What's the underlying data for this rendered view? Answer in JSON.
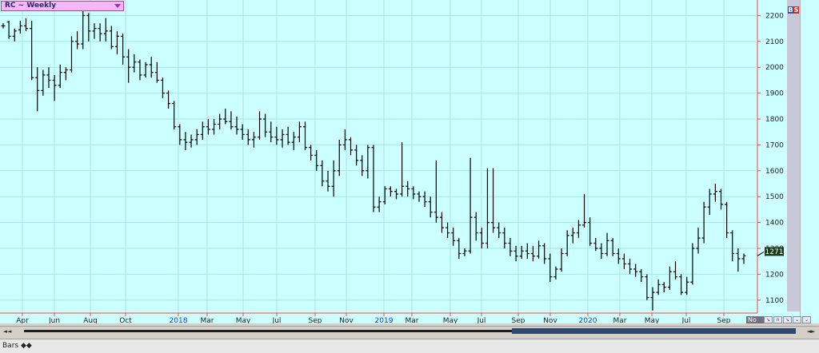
{
  "window": {
    "title": "RC ~ Weekly"
  },
  "buttons": {
    "buy": "B",
    "sell": "S"
  },
  "nav": {
    "date_corner": "No"
  },
  "bottom": {
    "tab_label": "Bars ◆◆"
  },
  "colors": {
    "background": "#ccffff",
    "axis": "#ff4040",
    "bars": "#000000",
    "price_label_bg": "#1a3a1a"
  },
  "chart_data": {
    "type": "bar",
    "title": "RC ~ Weekly",
    "ylim": [
      1050,
      2260
    ],
    "yticks": [
      1100,
      1200,
      1300,
      1400,
      1500,
      1600,
      1700,
      1800,
      1900,
      2000,
      2100,
      2200
    ],
    "x_labels": [
      "Apr",
      "Jun",
      "Aug",
      "Oct",
      "2018",
      "Mar",
      "May",
      "Jul",
      "Sep",
      "Nov",
      "2019",
      "Mar",
      "May",
      "Jul",
      "Sep",
      "Nov",
      "2020",
      "Mar",
      "May",
      "Jul",
      "Sep"
    ],
    "last_price": "1271",
    "grid": true,
    "bars": [
      [
        2160,
        2170,
        2150,
        2160
      ],
      [
        2175,
        2180,
        2110,
        2120
      ],
      [
        2120,
        2150,
        2100,
        2140
      ],
      [
        2145,
        2180,
        2130,
        2160
      ],
      [
        2160,
        2190,
        2140,
        2150
      ],
      [
        2150,
        2180,
        1950,
        1960
      ],
      [
        1960,
        2000,
        1830,
        1910
      ],
      [
        1910,
        1990,
        1890,
        1970
      ],
      [
        1970,
        2000,
        1920,
        1950
      ],
      [
        1950,
        1970,
        1870,
        1930
      ],
      [
        1930,
        2010,
        1920,
        1980
      ],
      [
        1980,
        2000,
        1950,
        1990
      ],
      [
        1990,
        2120,
        1980,
        2100
      ],
      [
        2100,
        2140,
        2070,
        2090
      ],
      [
        2090,
        2230,
        2070,
        2200
      ],
      [
        2200,
        2210,
        2100,
        2140
      ],
      [
        2140,
        2170,
        2110,
        2150
      ],
      [
        2150,
        2170,
        2100,
        2130
      ],
      [
        2130,
        2190,
        2100,
        2140
      ],
      [
        2140,
        2160,
        2070,
        2080
      ],
      [
        2080,
        2140,
        2050,
        2120
      ],
      [
        2120,
        2130,
        2010,
        2040
      ],
      [
        2040,
        2070,
        1940,
        2000
      ],
      [
        2000,
        2050,
        1980,
        2020
      ],
      [
        2020,
        2030,
        1950,
        1970
      ],
      [
        1970,
        2020,
        1960,
        2010
      ],
      [
        2010,
        2040,
        1960,
        1980
      ],
      [
        1980,
        2020,
        1940,
        1950
      ],
      [
        1950,
        1960,
        1880,
        1900
      ],
      [
        1900,
        1910,
        1840,
        1860
      ],
      [
        1860,
        1870,
        1760,
        1770
      ],
      [
        1770,
        1780,
        1700,
        1720
      ],
      [
        1720,
        1750,
        1680,
        1710
      ],
      [
        1710,
        1740,
        1690,
        1720
      ],
      [
        1720,
        1760,
        1700,
        1740
      ],
      [
        1740,
        1790,
        1720,
        1770
      ],
      [
        1770,
        1800,
        1740,
        1760
      ],
      [
        1760,
        1800,
        1740,
        1780
      ],
      [
        1780,
        1820,
        1760,
        1800
      ],
      [
        1800,
        1840,
        1780,
        1790
      ],
      [
        1790,
        1830,
        1760,
        1770
      ],
      [
        1770,
        1810,
        1740,
        1760
      ],
      [
        1760,
        1780,
        1720,
        1740
      ],
      [
        1740,
        1760,
        1700,
        1720
      ],
      [
        1720,
        1750,
        1690,
        1730
      ],
      [
        1730,
        1830,
        1720,
        1800
      ],
      [
        1800,
        1820,
        1730,
        1750
      ],
      [
        1750,
        1790,
        1710,
        1730
      ],
      [
        1730,
        1770,
        1700,
        1720
      ],
      [
        1720,
        1760,
        1690,
        1740
      ],
      [
        1740,
        1770,
        1700,
        1710
      ],
      [
        1710,
        1750,
        1680,
        1730
      ],
      [
        1730,
        1790,
        1710,
        1770
      ],
      [
        1770,
        1790,
        1680,
        1690
      ],
      [
        1690,
        1700,
        1640,
        1660
      ],
      [
        1660,
        1680,
        1600,
        1620
      ],
      [
        1620,
        1640,
        1540,
        1560
      ],
      [
        1560,
        1600,
        1520,
        1540
      ],
      [
        1540,
        1640,
        1500,
        1600
      ],
      [
        1600,
        1720,
        1580,
        1700
      ],
      [
        1700,
        1760,
        1680,
        1720
      ],
      [
        1720,
        1730,
        1660,
        1680
      ],
      [
        1680,
        1700,
        1620,
        1640
      ],
      [
        1640,
        1660,
        1580,
        1600
      ],
      [
        1600,
        1700,
        1570,
        1690
      ],
      [
        1690,
        1700,
        1440,
        1460
      ],
      [
        1460,
        1500,
        1440,
        1480
      ],
      [
        1480,
        1540,
        1470,
        1530
      ],
      [
        1530,
        1540,
        1500,
        1520
      ],
      [
        1520,
        1530,
        1490,
        1510
      ],
      [
        1510,
        1710,
        1500,
        1540
      ],
      [
        1540,
        1560,
        1500,
        1530
      ],
      [
        1530,
        1540,
        1490,
        1510
      ],
      [
        1510,
        1520,
        1480,
        1500
      ],
      [
        1500,
        1520,
        1460,
        1480
      ],
      [
        1480,
        1500,
        1420,
        1440
      ],
      [
        1440,
        1640,
        1400,
        1420
      ],
      [
        1420,
        1440,
        1360,
        1380
      ],
      [
        1380,
        1400,
        1340,
        1360
      ],
      [
        1360,
        1380,
        1310,
        1330
      ],
      [
        1330,
        1340,
        1260,
        1280
      ],
      [
        1280,
        1300,
        1270,
        1290
      ],
      [
        1290,
        1650,
        1280,
        1420
      ],
      [
        1420,
        1440,
        1330,
        1360
      ],
      [
        1360,
        1380,
        1300,
        1320
      ],
      [
        1320,
        1610,
        1300,
        1400
      ],
      [
        1400,
        1610,
        1360,
        1380
      ],
      [
        1380,
        1400,
        1340,
        1360
      ],
      [
        1360,
        1380,
        1300,
        1320
      ],
      [
        1320,
        1340,
        1270,
        1290
      ],
      [
        1290,
        1310,
        1250,
        1270
      ],
      [
        1270,
        1310,
        1260,
        1290
      ],
      [
        1290,
        1320,
        1260,
        1280
      ],
      [
        1280,
        1310,
        1250,
        1270
      ],
      [
        1270,
        1330,
        1260,
        1310
      ],
      [
        1310,
        1320,
        1240,
        1260
      ],
      [
        1260,
        1280,
        1170,
        1190
      ],
      [
        1190,
        1230,
        1180,
        1220
      ],
      [
        1220,
        1300,
        1210,
        1280
      ],
      [
        1280,
        1370,
        1270,
        1350
      ],
      [
        1350,
        1380,
        1320,
        1360
      ],
      [
        1360,
        1410,
        1340,
        1390
      ],
      [
        1390,
        1510,
        1380,
        1400
      ],
      [
        1400,
        1420,
        1310,
        1320
      ],
      [
        1320,
        1340,
        1290,
        1300
      ],
      [
        1300,
        1320,
        1260,
        1280
      ],
      [
        1280,
        1360,
        1270,
        1330
      ],
      [
        1330,
        1340,
        1270,
        1280
      ],
      [
        1280,
        1300,
        1240,
        1260
      ],
      [
        1260,
        1280,
        1220,
        1240
      ],
      [
        1240,
        1260,
        1200,
        1220
      ],
      [
        1220,
        1240,
        1190,
        1210
      ],
      [
        1210,
        1220,
        1170,
        1190
      ],
      [
        1190,
        1200,
        1100,
        1110
      ],
      [
        1110,
        1150,
        1060,
        1130
      ],
      [
        1130,
        1180,
        1120,
        1160
      ],
      [
        1160,
        1170,
        1130,
        1150
      ],
      [
        1150,
        1230,
        1140,
        1210
      ],
      [
        1210,
        1250,
        1180,
        1190
      ],
      [
        1190,
        1200,
        1120,
        1130
      ],
      [
        1130,
        1190,
        1120,
        1170
      ],
      [
        1170,
        1320,
        1160,
        1300
      ],
      [
        1300,
        1380,
        1280,
        1340
      ],
      [
        1340,
        1480,
        1320,
        1460
      ],
      [
        1460,
        1530,
        1430,
        1510
      ],
      [
        1510,
        1550,
        1480,
        1520
      ],
      [
        1520,
        1530,
        1450,
        1470
      ],
      [
        1470,
        1480,
        1340,
        1360
      ],
      [
        1360,
        1370,
        1250,
        1280
      ],
      [
        1280,
        1300,
        1210,
        1260
      ],
      [
        1260,
        1280,
        1240,
        1271
      ]
    ]
  }
}
